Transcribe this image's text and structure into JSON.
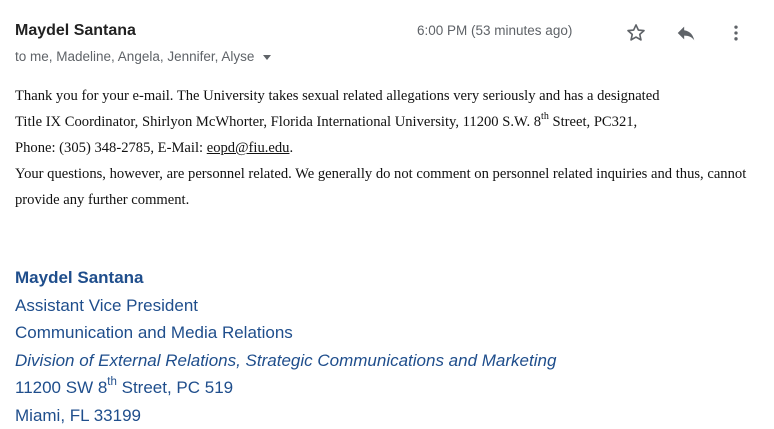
{
  "header": {
    "sender_name": "Maydel Santana",
    "recipients": "to me, Madeline, Angela, Jennifer, Alyse",
    "timestamp": "6:00 PM (53 minutes ago)",
    "icons": {
      "star": "star-outline-icon",
      "reply": "reply-icon",
      "more": "more-vertical-icon"
    }
  },
  "body": {
    "line1": "Thank you for your e-mail.  The University takes sexual related allegations very seriously and has a designated",
    "line2_before_sup": "Title IX Coordinator, Shirlyon McWhorter, Florida International University, 11200 S.W. 8",
    "line2_sup": "th",
    "line2_after_sup": " Street, PC321,",
    "line3_prefix": "Phone: (305) 348-2785, E-Mail: ",
    "email_link": "eopd@fiu.edu",
    "line3_suffix": ".",
    "paragraph2": "Your questions, however, are personnel related.  We generally do not comment on personnel related inquiries and thus, cannot provide any further comment."
  },
  "signature": {
    "name": "Maydel Santana",
    "title": "Assistant Vice President",
    "department": "Communication and Media Relations",
    "division": "Division of External Relations, Strategic Communications and Marketing",
    "address_before_sup": "11200 SW 8",
    "address_sup": "th",
    "address_after_sup": " Street, PC 519",
    "city": "Miami, FL 33199"
  },
  "colors": {
    "signature": "#1f4e8c",
    "secondary_text": "#5f6368",
    "body_text": "#111111"
  }
}
